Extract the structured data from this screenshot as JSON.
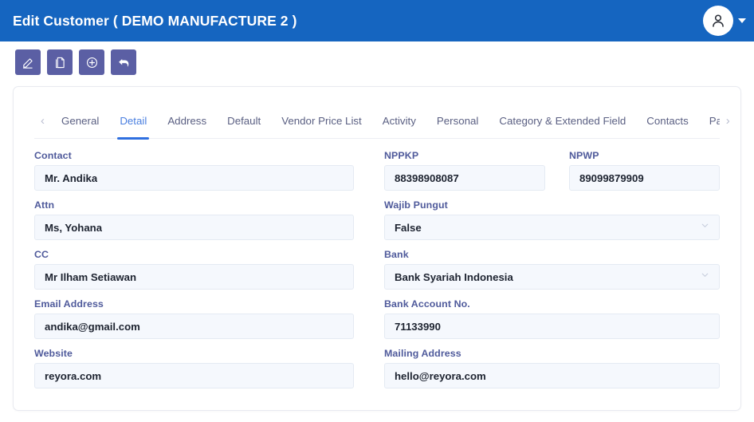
{
  "header": {
    "title": "Edit Customer ( DEMO MANUFACTURE 2 )",
    "avatar_icon": "user-avatar-icon",
    "caret_icon": "chevron-down-icon",
    "background_color": "#1565c0"
  },
  "toolbar": {
    "buttons": [
      {
        "name": "edit-button",
        "icon": "pencil-icon"
      },
      {
        "name": "copy-button",
        "icon": "duplicate-pages-icon"
      },
      {
        "name": "add-button",
        "icon": "plus-circle-icon"
      },
      {
        "name": "back-button",
        "icon": "back-arrow-icon"
      }
    ],
    "button_color": "#5b5fa4"
  },
  "tabs": {
    "prev_arrow": "‹",
    "next_arrow": "›",
    "active_color": "#4a7fe0",
    "items": [
      {
        "label": "General",
        "active": false
      },
      {
        "label": "Detail",
        "active": true
      },
      {
        "label": "Address",
        "active": false
      },
      {
        "label": "Default",
        "active": false
      },
      {
        "label": "Vendor Price List",
        "active": false
      },
      {
        "label": "Activity",
        "active": false
      },
      {
        "label": "Personal",
        "active": false
      },
      {
        "label": "Category & Extended Field",
        "active": false
      },
      {
        "label": "Contacts",
        "active": false
      },
      {
        "label": "Part Alia",
        "active": false
      }
    ]
  },
  "form": {
    "left": {
      "contact": {
        "label": "Contact",
        "value": "Mr. Andika"
      },
      "attn": {
        "label": "Attn",
        "value": "Ms, Yohana"
      },
      "cc": {
        "label": "CC",
        "value": "Mr Ilham Setiawan"
      },
      "email_address": {
        "label": "Email Address",
        "value": "andika@gmail.com"
      },
      "website": {
        "label": "Website",
        "value": "reyora.com"
      }
    },
    "right": {
      "nppkp": {
        "label": "NPPKP",
        "value": "88398908087"
      },
      "npwp": {
        "label": "NPWP",
        "value": "89099879909"
      },
      "wajib_pungut": {
        "label": "Wajib Pungut",
        "value": "False",
        "type": "select"
      },
      "bank": {
        "label": "Bank",
        "value": "Bank Syariah Indonesia",
        "type": "select"
      },
      "bank_account_no": {
        "label": "Bank Account No.",
        "value": "71133990"
      },
      "mailing_address": {
        "label": "Mailing Address",
        "value": "hello@reyora.com"
      }
    }
  }
}
